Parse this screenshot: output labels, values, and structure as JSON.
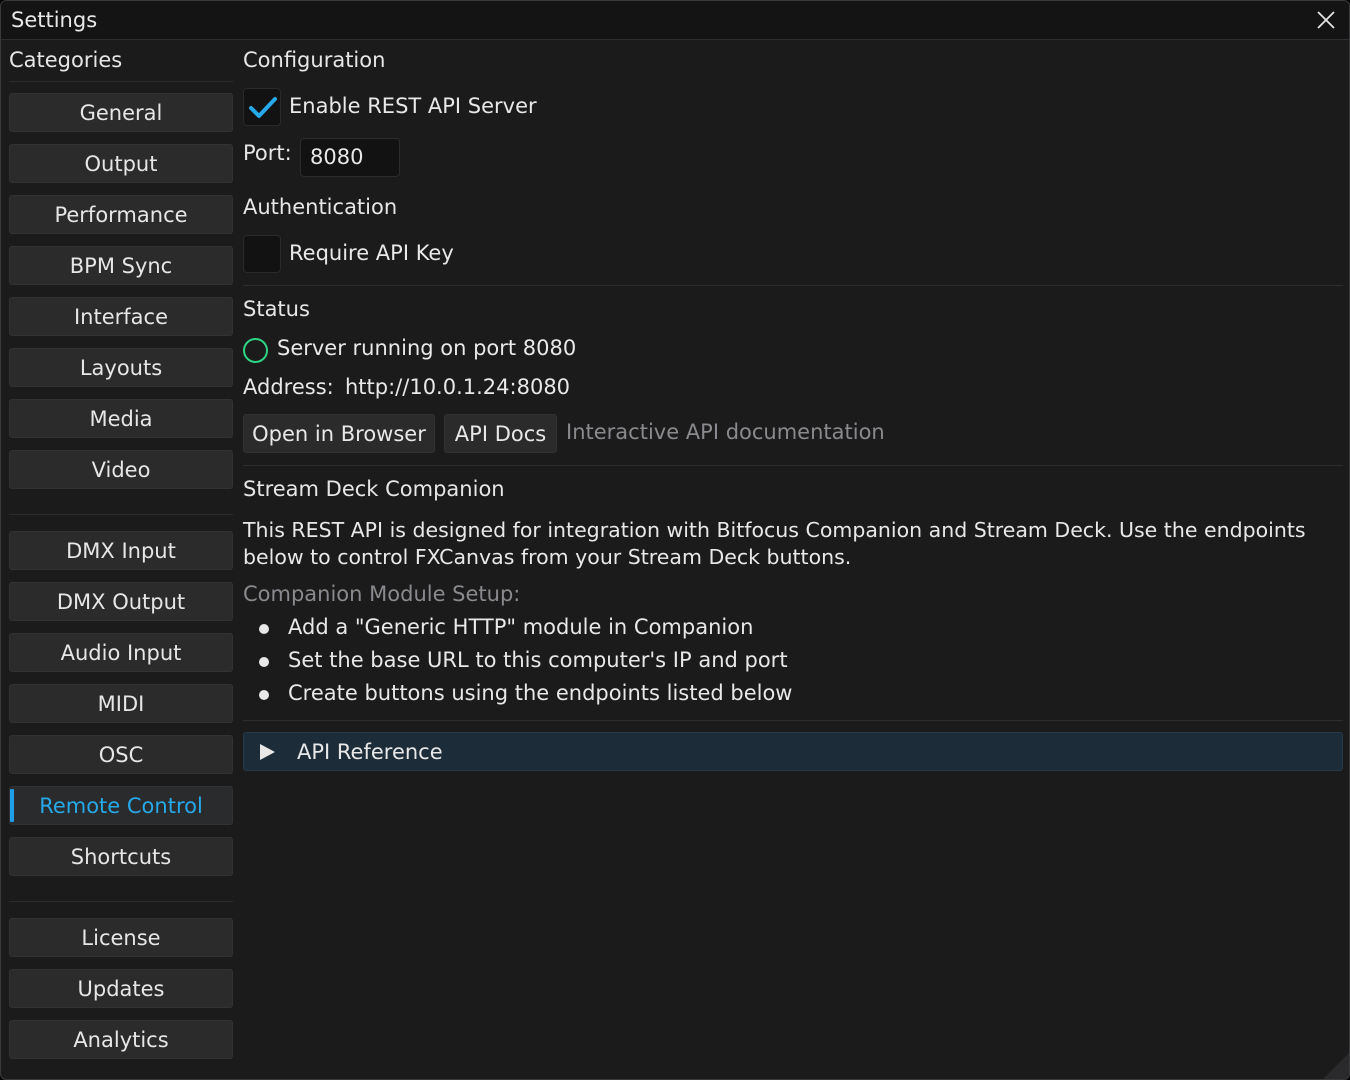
{
  "window": {
    "title": "Settings"
  },
  "sidebar": {
    "header": "Categories",
    "items": [
      {
        "label": "General"
      },
      {
        "label": "Output"
      },
      {
        "label": "Performance"
      },
      {
        "label": "BPM Sync"
      },
      {
        "label": "Interface"
      },
      {
        "label": "Layouts"
      },
      {
        "label": "Media"
      },
      {
        "label": "Video"
      },
      {
        "label": "DMX Input"
      },
      {
        "label": "DMX Output"
      },
      {
        "label": "Audio Input"
      },
      {
        "label": "MIDI"
      },
      {
        "label": "OSC"
      },
      {
        "label": "Remote Control",
        "active": true
      },
      {
        "label": "Shortcuts"
      },
      {
        "label": "License"
      },
      {
        "label": "Updates"
      },
      {
        "label": "Analytics"
      }
    ]
  },
  "main": {
    "configuration": {
      "heading": "Configuration",
      "enable_rest": {
        "label": "Enable REST API Server",
        "checked": true
      },
      "port_label": "Port:",
      "port_value": "8080"
    },
    "authentication": {
      "heading": "Authentication",
      "require_key": {
        "label": "Require API Key",
        "checked": false
      }
    },
    "status": {
      "heading": "Status",
      "running_text": "Server running on port 8080",
      "address_label": "Address:",
      "address_value": "http://10.0.1.24:8080",
      "open_browser_label": "Open in Browser",
      "api_docs_label": "API Docs",
      "api_docs_hint": "Interactive API documentation"
    },
    "companion": {
      "heading": "Stream Deck Companion",
      "description": "This REST API is designed for integration with Bitfocus Companion and Stream Deck. Use the endpoints below to control FXCanvas from your Stream Deck buttons.",
      "setup_heading": "Companion Module Setup:",
      "steps": [
        "Add a \"Generic HTTP\" module in Companion",
        "Set the base URL to this computer's IP and port",
        "Create buttons using the endpoints listed below"
      ]
    },
    "api_reference": {
      "label": "API Reference",
      "expanded": false
    }
  },
  "colors": {
    "accent": "#26a9e8",
    "status_ok": "#2fd384",
    "panel_bg": "#1b1b1c",
    "api_ref_bg": "#1c2c38"
  }
}
